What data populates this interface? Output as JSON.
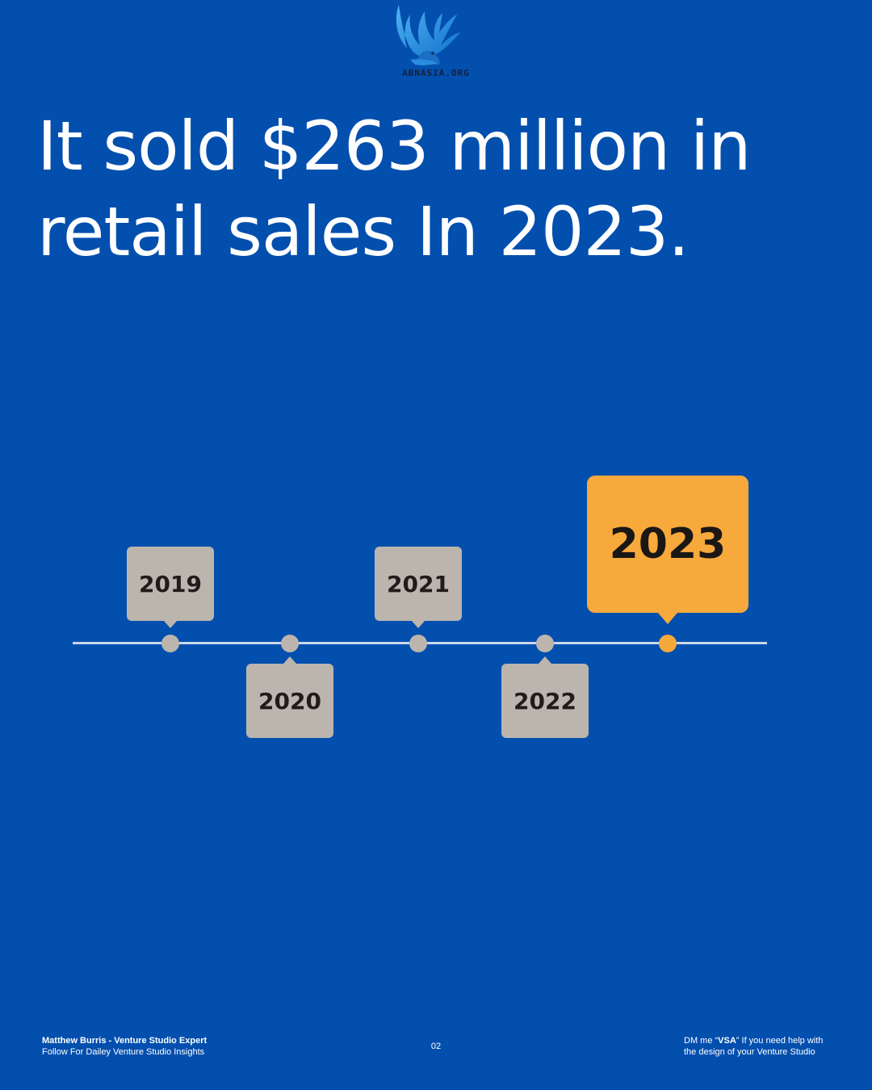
{
  "brand": {
    "logo_text": "ABNASIA.ORG",
    "logo_color": "#1f8fe0"
  },
  "headline": "It sold $263 million in retail sales In 2023.",
  "timeline": {
    "years": [
      "2019",
      "2020",
      "2021",
      "2022",
      "2023"
    ],
    "highlighted": "2023",
    "colors": {
      "background": "#034fae",
      "marker": "#bcb5ae",
      "highlight": "#f8a93c",
      "line": "#c9d6ea"
    }
  },
  "footer": {
    "author_name": "Matthew Burris - Venture Studio Expert",
    "author_tagline": "Follow For Dailey Venture Studio Insights",
    "page_number": "02",
    "cta_prefix": "DM me “",
    "cta_keyword": "VSA",
    "cta_middle": "” If you need help with",
    "cta_line2": "the design of your Venture Studio"
  }
}
